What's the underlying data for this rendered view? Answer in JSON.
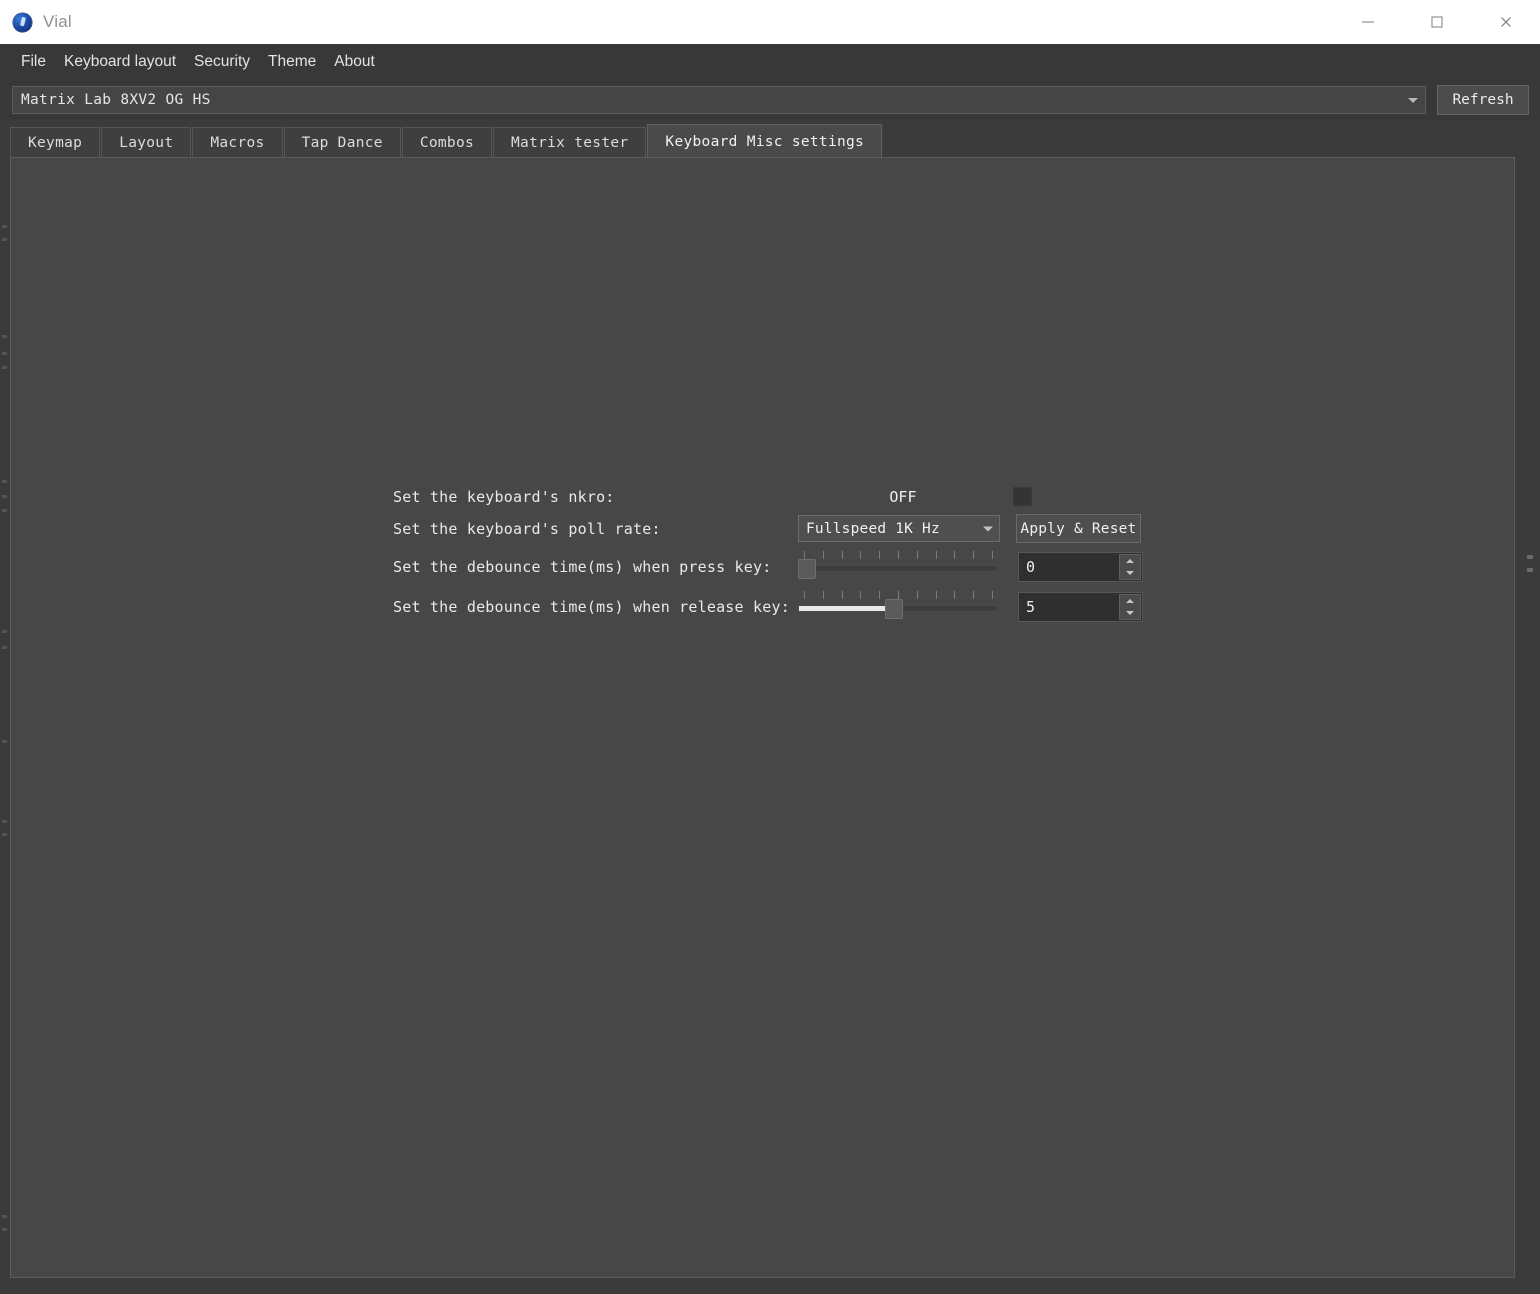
{
  "window": {
    "app_title": "Vial",
    "logo_icon": "vial-logo-icon",
    "minimize_label": "Minimize",
    "maximize_label": "Maximize",
    "close_label": "Close"
  },
  "menubar": {
    "items": [
      {
        "label": "File"
      },
      {
        "label": "Keyboard layout"
      },
      {
        "label": "Security"
      },
      {
        "label": "Theme"
      },
      {
        "label": "About"
      }
    ]
  },
  "device_bar": {
    "selected_keyboard": "Matrix Lab 8XV2 OG HS",
    "dropdown_icon": "chevron-down-icon",
    "refresh_label": "Refresh"
  },
  "tabs": [
    {
      "label": "Keymap",
      "active": false
    },
    {
      "label": "Layout",
      "active": false
    },
    {
      "label": "Macros",
      "active": false
    },
    {
      "label": "Tap Dance",
      "active": false
    },
    {
      "label": "Combos",
      "active": false
    },
    {
      "label": "Matrix tester",
      "active": false
    },
    {
      "label": "Keyboard Misc settings",
      "active": true
    }
  ],
  "misc_settings": {
    "nkro": {
      "label": "Set the keyboard's nkro:",
      "state_text": "OFF",
      "checked": false
    },
    "poll_rate": {
      "label": "Set the keyboard's poll rate:",
      "selected": "Fullspeed 1K Hz",
      "dropdown_icon": "chevron-down-icon",
      "apply_label": "Apply & Reset"
    },
    "debounce_press": {
      "label": "Set the debounce time(ms) when press key:",
      "value": "0",
      "slider_percent": 0,
      "tick_count": 11
    },
    "debounce_release": {
      "label": "Set the debounce time(ms) when release key:",
      "value": "5",
      "slider_percent": 48,
      "tick_count": 11
    }
  },
  "colors": {
    "titlebar_bg": "#ffffff",
    "menubar_bg": "#383838",
    "content_bg": "#474747",
    "tab_active_bg": "#4a4a4a",
    "accent_logo": "#1b49a8"
  }
}
